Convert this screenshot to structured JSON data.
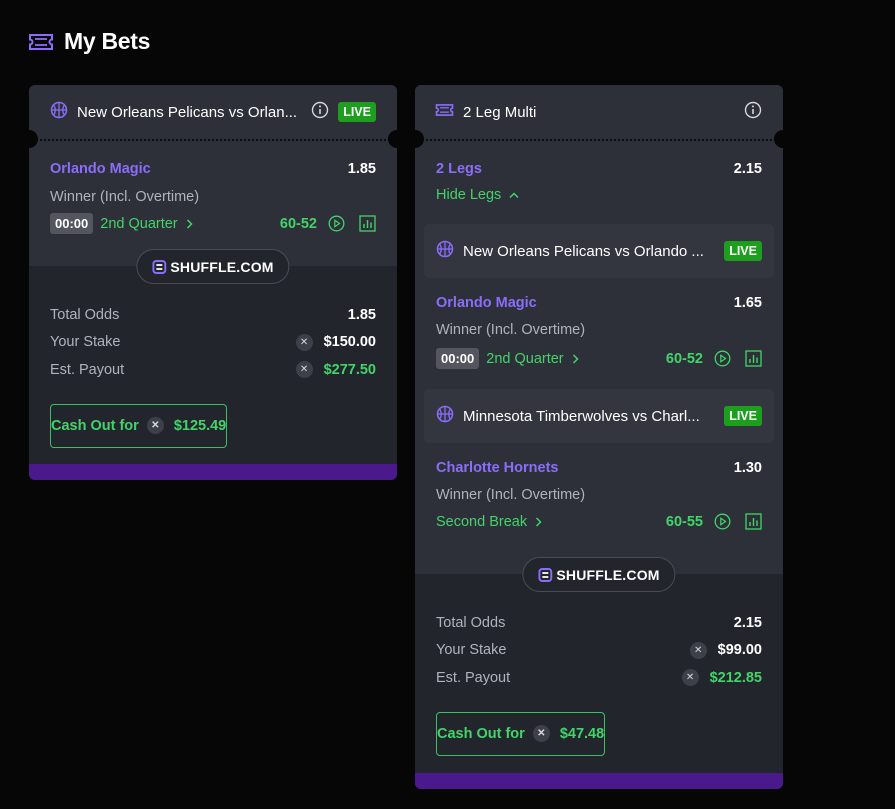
{
  "page": {
    "title": "My Bets",
    "title_icon": "ticket-icon"
  },
  "colors": {
    "accent_purple": "#8b6dfa",
    "live_green": "#1e9e1e",
    "positive_green": "#44d36a",
    "footer_purple": "#4a1a8c"
  },
  "bets": [
    {
      "header": {
        "title": "New Orleans Pelicans vs Orlan...",
        "live": "LIVE",
        "icon": "basketball-icon"
      },
      "selection": {
        "name": "Orlando Magic",
        "odds": "1.85",
        "market": "Winner (Incl. Overtime)",
        "clock": "00:00",
        "period": "2nd Quarter",
        "score": "60-52"
      },
      "brand": "SHUFFLE.COM",
      "totals": {
        "odds_label": "Total Odds",
        "odds_value": "1.85",
        "stake_label": "Your Stake",
        "stake_value": "$150.00",
        "payout_label": "Est. Payout",
        "payout_value": "$277.50"
      },
      "cashout": {
        "label": "Cash Out for",
        "amount": "$125.49"
      }
    },
    {
      "header": {
        "title": "2 Leg Multi",
        "icon": "ticket-icon"
      },
      "legs_count": "2 Legs",
      "multi_odds": "2.15",
      "hide_legs": "Hide Legs",
      "legs": [
        {
          "title": "New Orleans Pelicans vs Orlando ...",
          "live": "LIVE",
          "name": "Orlando Magic",
          "odds": "1.65",
          "market": "Winner (Incl. Overtime)",
          "clock": "00:00",
          "period": "2nd Quarter",
          "score": "60-52"
        },
        {
          "title": "Minnesota Timberwolves vs Charl...",
          "live": "LIVE",
          "name": "Charlotte Hornets",
          "odds": "1.30",
          "market": "Winner (Incl. Overtime)",
          "period": "Second Break",
          "score": "60-55"
        }
      ],
      "brand": "SHUFFLE.COM",
      "totals": {
        "odds_label": "Total Odds",
        "odds_value": "2.15",
        "stake_label": "Your Stake",
        "stake_value": "$99.00",
        "payout_label": "Est. Payout",
        "payout_value": "$212.85"
      },
      "cashout": {
        "label": "Cash Out for",
        "amount": "$47.48"
      }
    }
  ]
}
